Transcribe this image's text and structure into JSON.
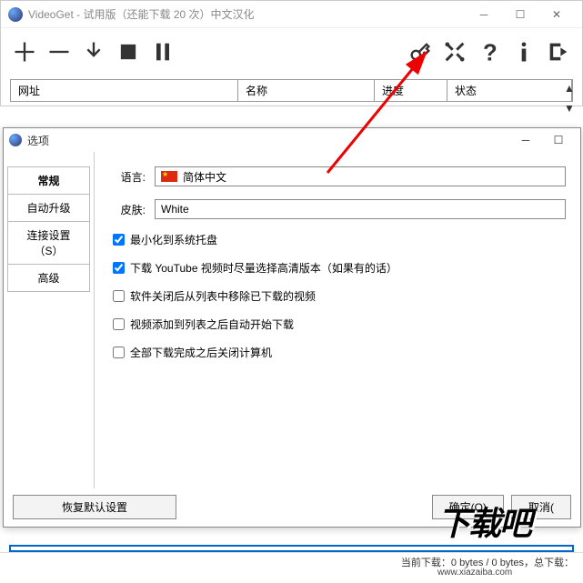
{
  "mainWindow": {
    "title": "VideoGet - 试用版（还能下载 20 次）中文汉化",
    "columns": {
      "url": "网址",
      "name": "名称",
      "progress": "进度",
      "status": "状态"
    }
  },
  "dialog": {
    "title": "选项",
    "tabs": {
      "general": "常规",
      "autoUpdate": "自动升级",
      "connection": "连接设置（S）",
      "advanced": "高级"
    },
    "labels": {
      "language": "语言:",
      "skin": "皮肤:"
    },
    "values": {
      "language": "简体中文",
      "skin": "White"
    },
    "checks": {
      "minimizeTray": "最小化到系统托盘",
      "youtubeHd": "下载 YouTube 视频时尽量选择高清版本（如果有的话）",
      "removeAfterClose": "软件关闭后从列表中移除已下载的视频",
      "autoStartAfterAdd": "视频添加到列表之后自动开始下载",
      "shutdownAfterAll": "全部下载完成之后关闭计算机"
    },
    "buttons": {
      "restore": "恢复默认设置",
      "ok": "确定(O)",
      "cancel": "取消("
    }
  },
  "statusBar": "当前下载：0 bytes / 0 bytes，总下载：",
  "watermark": {
    "brand": "下载吧",
    "url": "www.xiazaiba.com"
  }
}
